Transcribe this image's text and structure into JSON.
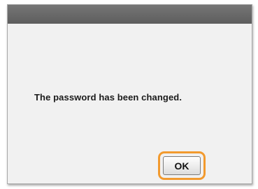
{
  "dialog": {
    "message": "The password has been changed.",
    "ok_label": "OK"
  },
  "colors": {
    "titlebar": "#666666",
    "dialog_background": "#f1f1f1",
    "focus_highlight": "#f29a2e"
  }
}
